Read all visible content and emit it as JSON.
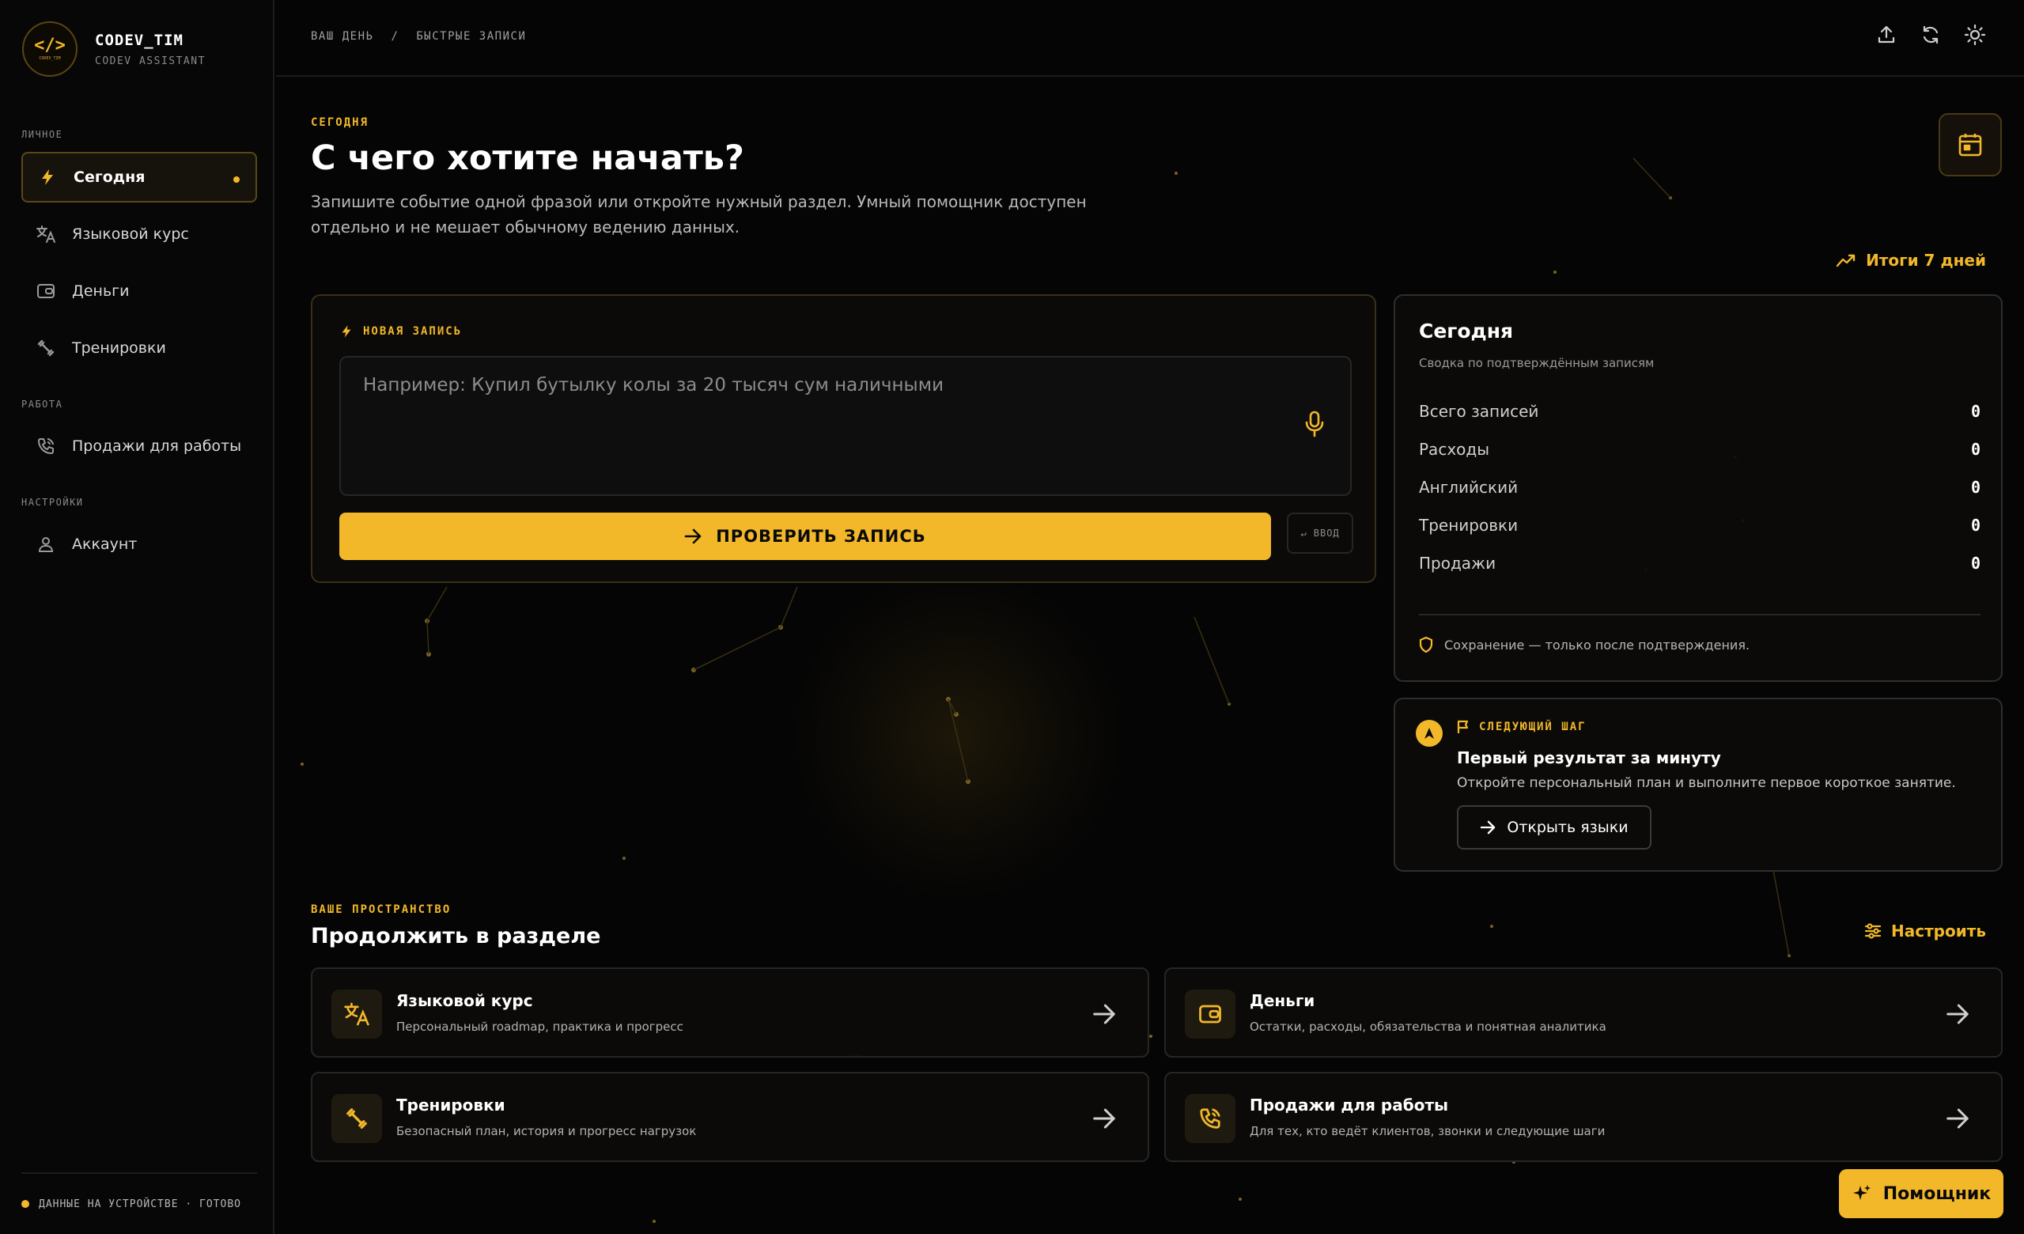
{
  "brand": {
    "name": "CODEV_TIM",
    "subtitle": "CODEV ASSISTANT",
    "logo_text": "</>",
    "logo_small": "CODEV_TIM"
  },
  "sidebar": {
    "sections": {
      "personal": "ЛИЧНОЕ",
      "work": "РАБОТА",
      "settings": "НАСТРОЙКИ"
    },
    "items": [
      {
        "label": "Сегодня",
        "icon": "bolt-icon",
        "active": true
      },
      {
        "label": "Языковой курс",
        "icon": "translate-icon"
      },
      {
        "label": "Деньги",
        "icon": "wallet-icon"
      },
      {
        "label": "Тренировки",
        "icon": "dumbbell-icon"
      },
      {
        "label": "Продажи для работы",
        "icon": "phone-icon"
      },
      {
        "label": "Аккаунт",
        "icon": "user-icon"
      }
    ],
    "footer": "ДАННЫЕ НА УСТРОЙСТВЕ · ГОТОВО"
  },
  "topbar": {
    "breadcrumb": [
      "ВАШ ДЕНЬ",
      "/",
      "БЫСТРЫЕ ЗАПИСИ"
    ],
    "icons": [
      "upload-icon",
      "sync-icon",
      "theme-icon"
    ]
  },
  "hero": {
    "eyebrow": "СЕГОДНЯ",
    "title": "С чего хотите начать?",
    "description": "Запишите событие одной фразой или откройте нужный раздел. Умный помощник доступен отдельно и не мешает обычному ведению данных.",
    "week_link": "Итоги 7 дней"
  },
  "new_entry": {
    "eyebrow": "НОВАЯ ЗАПИСЬ",
    "placeholder": "Например: Купил бутылку колы за 20 тысяч сум наличными",
    "submit_label": "ПРОВЕРИТЬ ЗАПИСЬ",
    "enter_label": "↵ ВВОД"
  },
  "today": {
    "title": "Сегодня",
    "subtitle": "Сводка по подтверждённым записям",
    "stats": [
      {
        "label": "Всего записей",
        "value": "0"
      },
      {
        "label": "Расходы",
        "value": "0"
      },
      {
        "label": "Английский",
        "value": "0"
      },
      {
        "label": "Тренировки",
        "value": "0"
      },
      {
        "label": "Продажи",
        "value": "0"
      }
    ],
    "note": "Сохранение — только после подтверждения."
  },
  "next_step": {
    "eyebrow": "СЛЕДУЮЩИЙ ШАГ",
    "title": "Первый результат за минуту",
    "description": "Откройте персональный план и выполните первое короткое занятие.",
    "button": "Открыть языки"
  },
  "space": {
    "eyebrow": "ВАШЕ ПРОСТРАНСТВО",
    "title": "Продолжить в разделе",
    "tune_link": "Настроить",
    "tiles": [
      {
        "title": "Языковой курс",
        "desc": "Персональный roadmap, практика и прогресс",
        "icon": "translate-icon"
      },
      {
        "title": "Деньги",
        "desc": "Остатки, расходы, обязательства и понятная аналитика",
        "icon": "wallet-icon"
      },
      {
        "title": "Тренировки",
        "desc": "Безопасный план, история и прогресс нагрузок",
        "icon": "dumbbell-icon"
      },
      {
        "title": "Продажи для работы",
        "desc": "Для тех, кто ведёт клиентов, звонки и следующие шаги",
        "icon": "phone-icon"
      }
    ]
  },
  "assistant_button": "Помощник",
  "colors": {
    "accent": "#f2b829",
    "background": "#050505",
    "card": "#0c0b09"
  }
}
